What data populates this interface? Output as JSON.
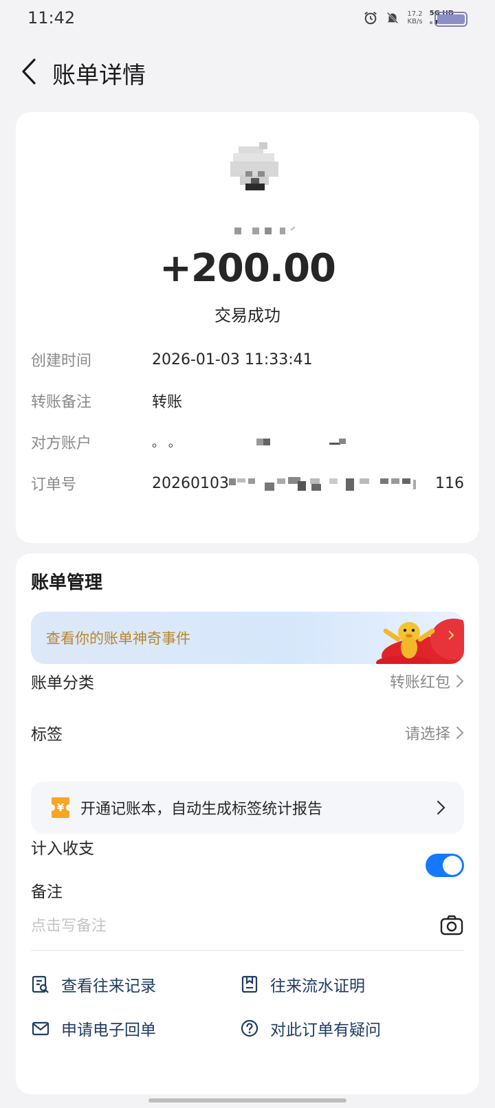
{
  "status_bar": {
    "time": "11:42",
    "net_speed_value": "17.2",
    "net_speed_unit": "KB/s",
    "network": "5G HD"
  },
  "nav": {
    "title": "账单详情"
  },
  "transaction": {
    "amount": "+200.00",
    "status": "交易成功",
    "details": [
      {
        "label": "创建时间",
        "value": "2026-01-03 11:33:41"
      },
      {
        "label": "转账备注",
        "value": "转账"
      },
      {
        "label": "对方账户",
        "value": "。 。"
      },
      {
        "label": "订单号",
        "value_prefix": "20260103",
        "value_suffix": "116"
      }
    ]
  },
  "management": {
    "title": "账单管理",
    "banner_text": "查看你的账单神奇事件",
    "category": {
      "label": "账单分类",
      "value": "转账红包"
    },
    "tag": {
      "label": "标签",
      "value": "请选择"
    },
    "promo_text": "开通记账本，自动生成标签统计报告",
    "promo_icon_glyph": "¥",
    "include_label": "计入收支",
    "include_on": true,
    "note_label": "备注",
    "note_placeholder": "点击写备注",
    "actions": [
      {
        "label": "查看往来记录",
        "icon": "records-search-icon"
      },
      {
        "label": "往来流水证明",
        "icon": "document-icon"
      },
      {
        "label": "申请电子回单",
        "icon": "mail-icon"
      },
      {
        "label": "对此订单有疑问",
        "icon": "help-circle-icon"
      }
    ]
  },
  "colors": {
    "accent": "#1677ff",
    "banner_text": "#b8862c",
    "action_text": "#1f3b63"
  }
}
